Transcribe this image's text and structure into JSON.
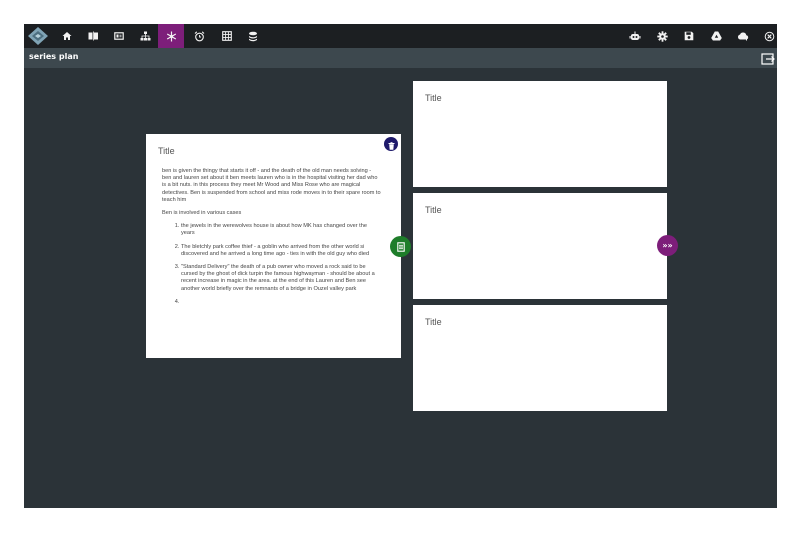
{
  "app": {
    "page_title": "series plan"
  },
  "toolbar": {
    "left_icons": [
      "home-icon",
      "book-icon",
      "card-icon",
      "sitemap-icon",
      "snowflake-icon",
      "alarm-clock-icon",
      "grid-icon",
      "layers-icon"
    ],
    "active_icon": "snowflake-icon",
    "right_icons": [
      "robot-icon",
      "gear-icon",
      "save-icon",
      "drive-icon",
      "cloud-upload-icon",
      "close-icon"
    ],
    "active_color": "#7d1e7a"
  },
  "main_card": {
    "title": "Title",
    "paragraph1": "ben is given the thingy that starts it off - and the death of the old man needs solving - ben and lauren set about it ben meets lauren who is in the hospital visiting her dad who is a bit nuts. in this process they meet Mr Wood and Miss Rose who are magical detectives. Ben is suspended from school and miss rode moves in to their spare room to teach him",
    "paragraph2": "Ben is involved in various cases",
    "list": [
      "the jewels in the werewolves house is about how MK has changed over the years",
      "The bletchly park coffee thief - a goblin who arrived from the other world si discovered and he arrived a long time ago - ties in with the old guy who died",
      "\"Standard Delivery\" the death of a pub owner who moved a rock said to be cursed by the ghost of dick turpin the famous highwayman - should be about a recent increase in magic in the area. at the end of this Lauren and Ben see another world briefly over the remnants of a bridge in Ouzel valley park",
      ""
    ]
  },
  "side_cards": [
    {
      "title": "Title"
    },
    {
      "title": "Title"
    },
    {
      "title": "Title"
    }
  ],
  "colors": {
    "background": "#2b3338",
    "topbar": "#1c1f22",
    "subbar": "#3d484e",
    "delete_button": "#1f1a6b",
    "list_button": "#1e7d2a",
    "next_button": "#7d1e7a"
  },
  "buttons": {
    "delete_icon": "trash-icon",
    "list_icon": "list-icon",
    "next_label": "»»",
    "exit_icon": "exit-icon"
  }
}
